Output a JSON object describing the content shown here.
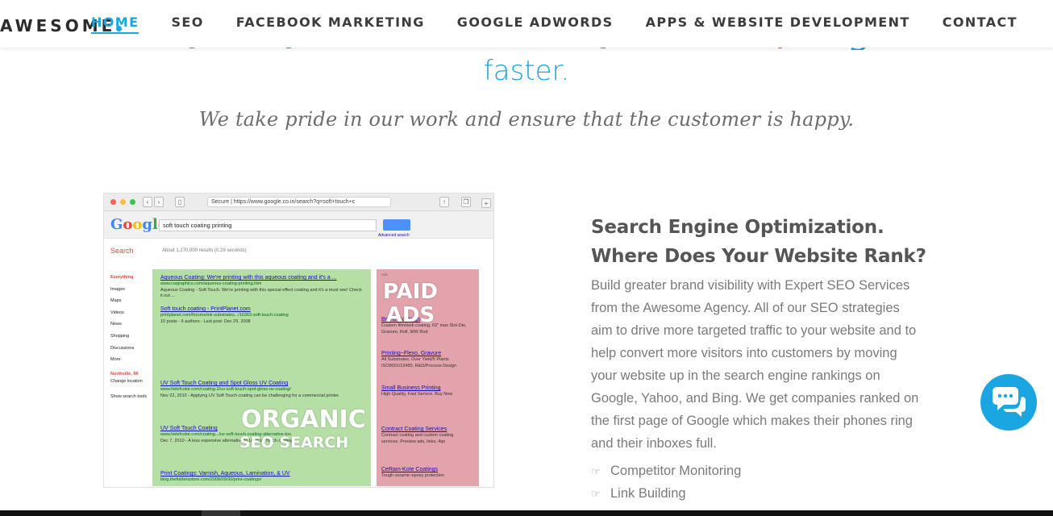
{
  "brand": {
    "logo_text": "AWESOME",
    "accent": "#1aa6e0"
  },
  "nav": {
    "items": [
      {
        "label": "HOME",
        "active": true
      },
      {
        "label": "SEO",
        "active": false
      },
      {
        "label": "FACEBOOK MARKETING",
        "active": false
      },
      {
        "label": "GOOGLE ADWORDS",
        "active": false
      },
      {
        "label": "APPS & WEBSITE DEVELOPMENT",
        "active": false
      },
      {
        "label": "CONTACT",
        "active": false
      }
    ]
  },
  "hero": {
    "headline_tail": "faster.",
    "tagline": "We take pride in our work and ensure that the customer is happy."
  },
  "screenshot": {
    "url": "Secure | https://www.google.co.in/search?q=soft+touch+c",
    "search_query": "soft touch coating printing",
    "advanced_search": "Advanced search",
    "search_label": "Search",
    "result_stats": "About 1,270,000 results (0.29 seconds)",
    "sidebar": [
      "Everything",
      "Images",
      "Maps",
      "Videos",
      "News",
      "Shopping",
      "Discussions",
      "More",
      "",
      "Northville, MI",
      "Change location",
      "",
      "Show search tools"
    ],
    "organic_results": [
      {
        "title": "Aqueous Coating: We're printing with this aqueous coating and it's a ...",
        "url": "www.cwgraphics.com/aqueous-coating-printing.htm",
        "snippet": "Aqueous Coating - Soft Touch. We're printing with this special effect coating and it's a must see! Check it out ..."
      },
      {
        "title": "Soft touch coating - PrintPlanet.com",
        "url": "printplanet.com/forums/ink-substrates.../16363-soft-touch-coating",
        "snippet": "10 posts - 6 authors - Last post: Dec 29, 2008"
      },
      {
        "title": "UV Soft Touch Coating and Spot Gloss UV Coating",
        "url": "www.hidefcolor.com/coating-2/uv-soft-touch-spot-gloss-uv-coating/",
        "snippet": "Nov 22, 2010 - Applying UV Soft Touch coating can be challenging for a commercial printer."
      },
      {
        "title": "UV Soft Touch Coating",
        "url": "www.hidefcolor.com/coating.../uv-soft-touch-coating-alternative-too",
        "snippet": "Dec 7, 2010 - A less expensive alternative to UV Soft Touch coating."
      },
      {
        "title": "Print Coatings: Varnish, Aqueous, Lamination, & UV",
        "url": "blog.thefoldersstore.com/2008/09/30/print-coatings/",
        "snippet": ""
      }
    ],
    "paid_results": [
      {
        "title": "Ads",
        "snippet": ""
      },
      {
        "title": "Brand Coatings",
        "snippet": "Custom film/web coating, 63\" max Slot-Die, Gravure, Roll, WW Rod"
      },
      {
        "title": "Printing~Flexo, Gravure",
        "snippet": "All Substrates; Over Yield/5 Plants ISO9001/13485; R&D/Process Design"
      },
      {
        "title": "Small Business Printing",
        "snippet": "High Quality, Fast Service. Buy Now"
      },
      {
        "title": "Contract Coating Services",
        "snippet": "Contract coating and custom coating services. Preview ads, links, 4qs"
      },
      {
        "title": "CeRam-Kote Coatings",
        "snippet": "Tough ceramic-epoxy protection"
      }
    ],
    "overlay_paid": "PAID ADS",
    "overlay_organic_1": "ORGANIC",
    "overlay_organic_2": "SEO SEARCH"
  },
  "section": {
    "title": "Search Engine Optimization. Where Does Your Website Rank?",
    "body": "Build greater brand visibility with Expert SEO Services from the Awesome Agency. All of our SEO strategies aim to drive more targeted traffic to your website and to help convert more visitors into customers by moving your website up in the search engine rankings on Google, Yahoo, and Bing. We get companies ranked on the first page of Google which makes their phones ring and their inboxes full.",
    "features": [
      "Competitor Monitoring",
      "Link Building"
    ],
    "feature_icon": "hand-pointing-icon"
  },
  "chat": {
    "icon": "chat-bubbles-icon"
  }
}
